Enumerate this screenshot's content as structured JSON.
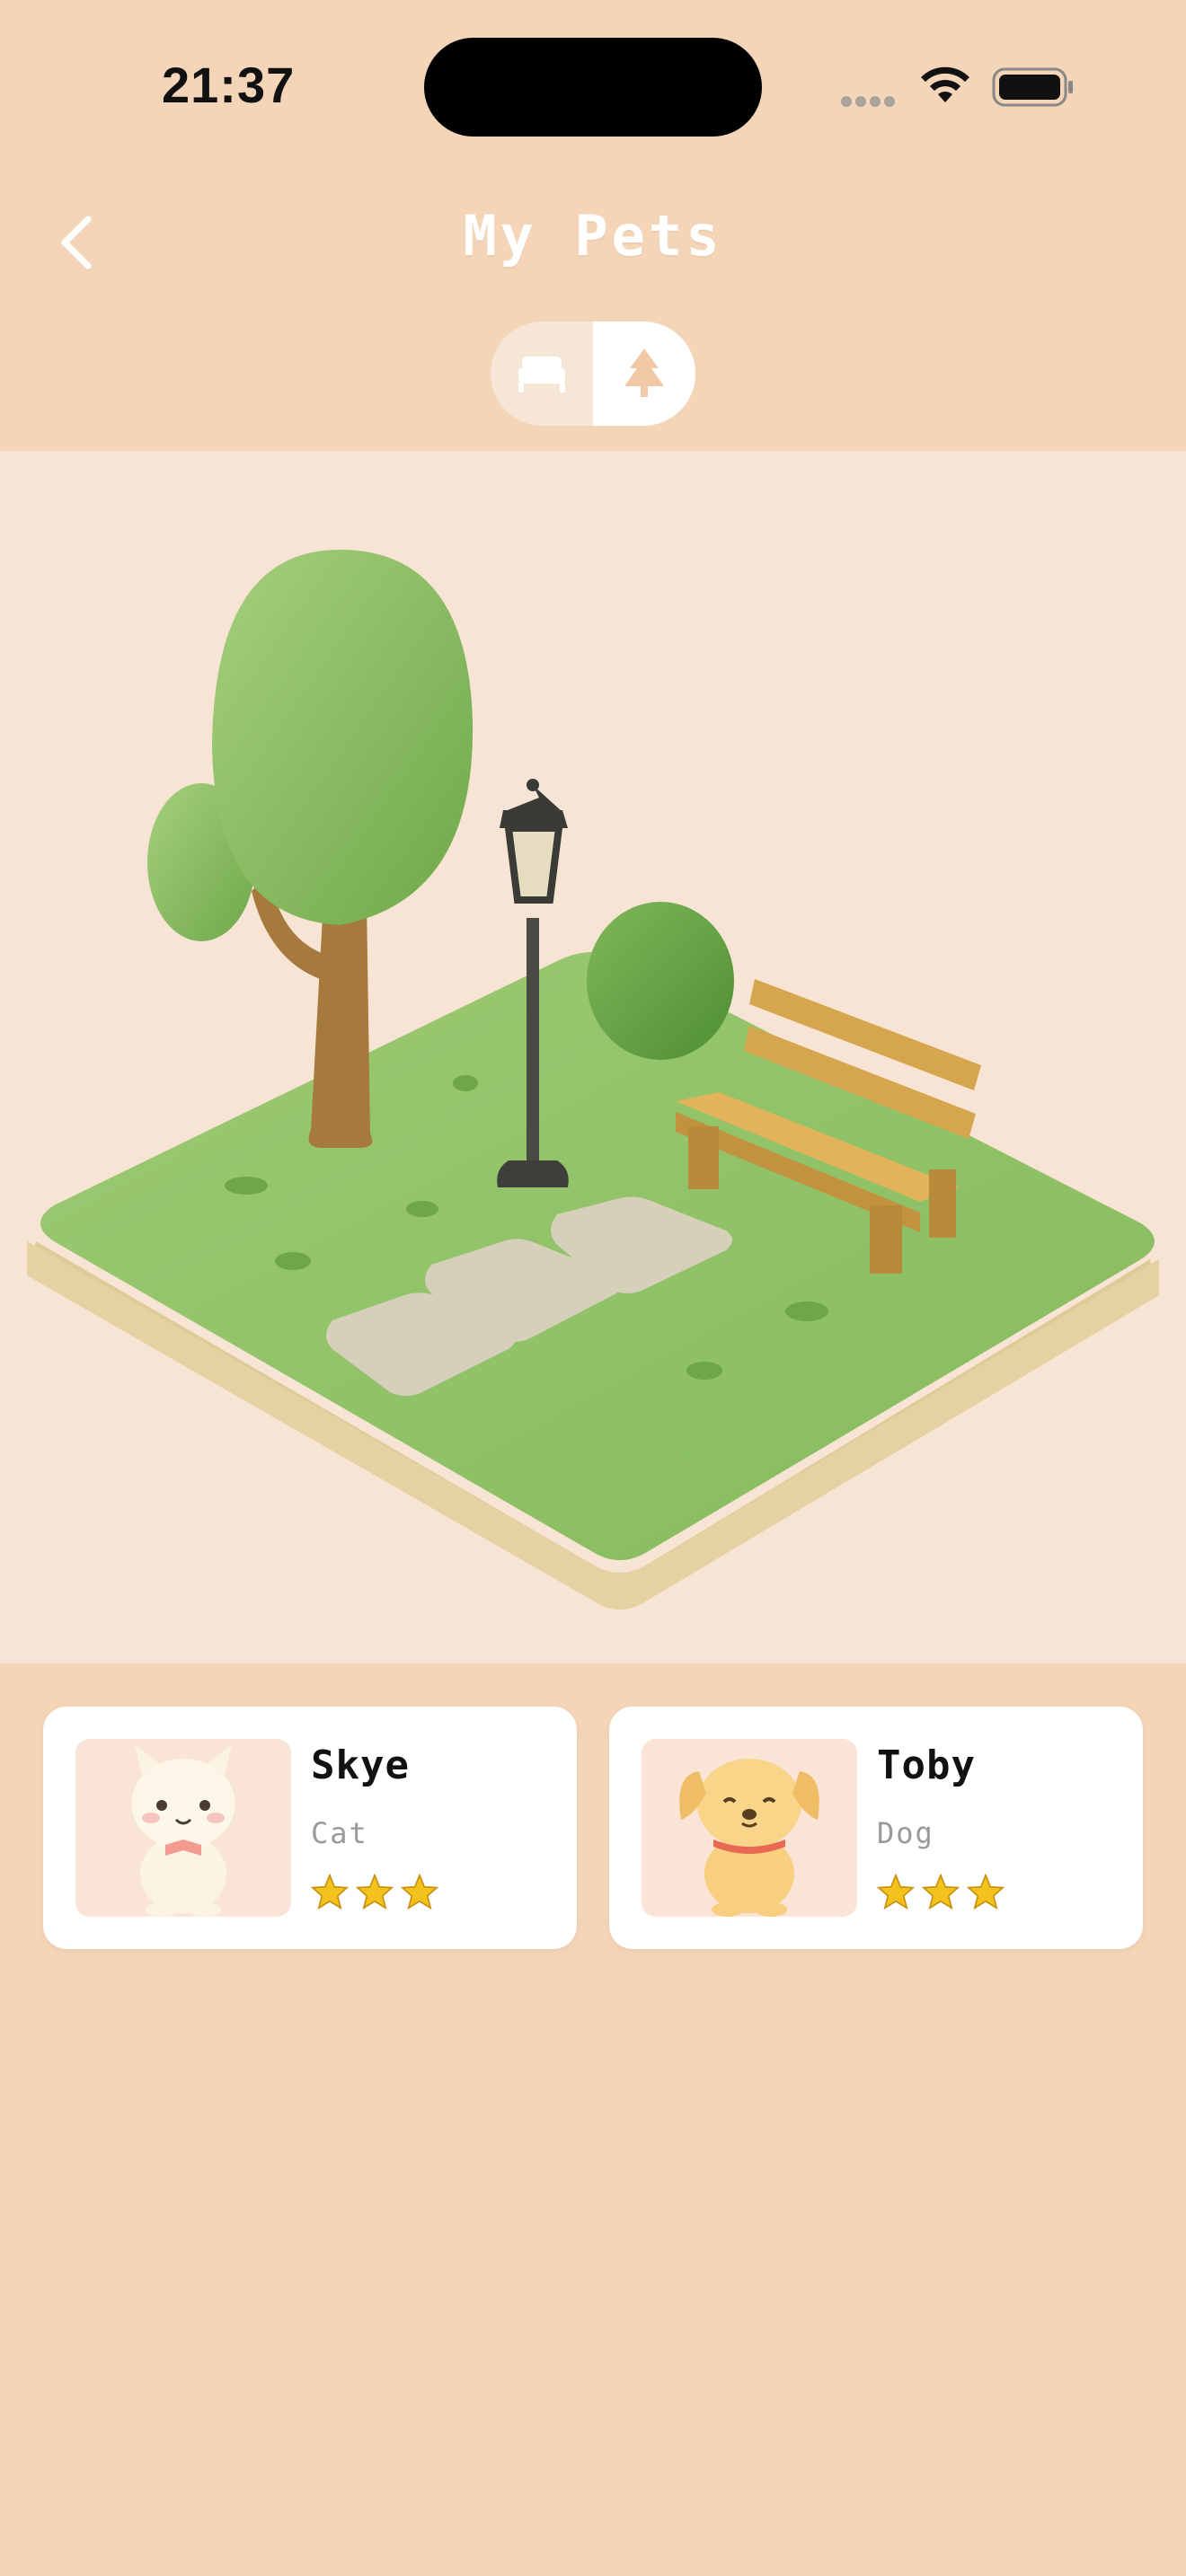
{
  "status_bar": {
    "time": "21:37"
  },
  "header": {
    "title": "My Pets"
  },
  "view_toggle": {
    "options": [
      {
        "icon": "bed-icon",
        "active": false
      },
      {
        "icon": "tree-icon",
        "active": true
      }
    ]
  },
  "scene": {
    "name": "park-diorama"
  },
  "pets": [
    {
      "name": "Skye",
      "type": "Cat",
      "stars": 3,
      "avatar": "cat-avatar-icon"
    },
    {
      "name": "Toby",
      "type": "Dog",
      "stars": 3,
      "avatar": "dog-avatar-icon"
    }
  ],
  "colors": {
    "background": "#f4d5b8",
    "scene_background": "#f8e4d4",
    "card": "#ffffff",
    "grass": "#8fc066",
    "star": "#f4c21c"
  }
}
